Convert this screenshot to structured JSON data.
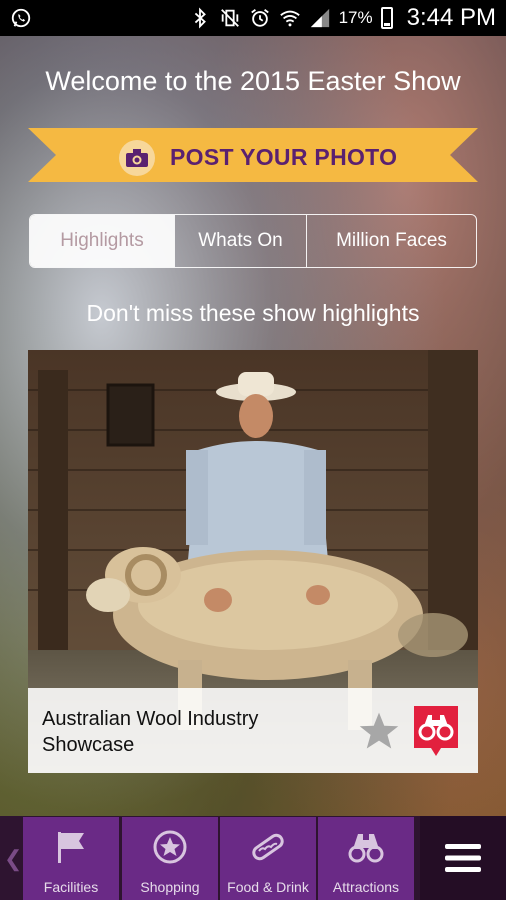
{
  "status_bar": {
    "battery": "17%",
    "time": "3:44 PM"
  },
  "header": {
    "title": "Welcome to the 2015 Easter Show"
  },
  "banner": {
    "label": "POST YOUR PHOTO",
    "color": "#f5b942",
    "text_color": "#5a2170"
  },
  "segments": [
    {
      "label": "Highlights",
      "active": true
    },
    {
      "label": "Whats On",
      "active": false
    },
    {
      "label": "Million Faces",
      "active": false
    }
  ],
  "subtitle": "Don't miss these show highlights",
  "highlight_card": {
    "caption": "Australian Wool Industry Showcase",
    "favorite_icon": "star-icon",
    "badge_icon": "binoculars-icon",
    "badge_color": "#e2203e"
  },
  "tab_bar": {
    "tabs": [
      {
        "label": "Facilities",
        "icon": "flag-icon"
      },
      {
        "label": "Shopping",
        "icon": "star-circle-icon"
      },
      {
        "label": "Food & Drink",
        "icon": "hotdog-icon"
      },
      {
        "label": "Attractions",
        "icon": "binoculars-icon"
      }
    ],
    "menu_icon": "hamburger-icon",
    "accent": "#6a2a86"
  }
}
